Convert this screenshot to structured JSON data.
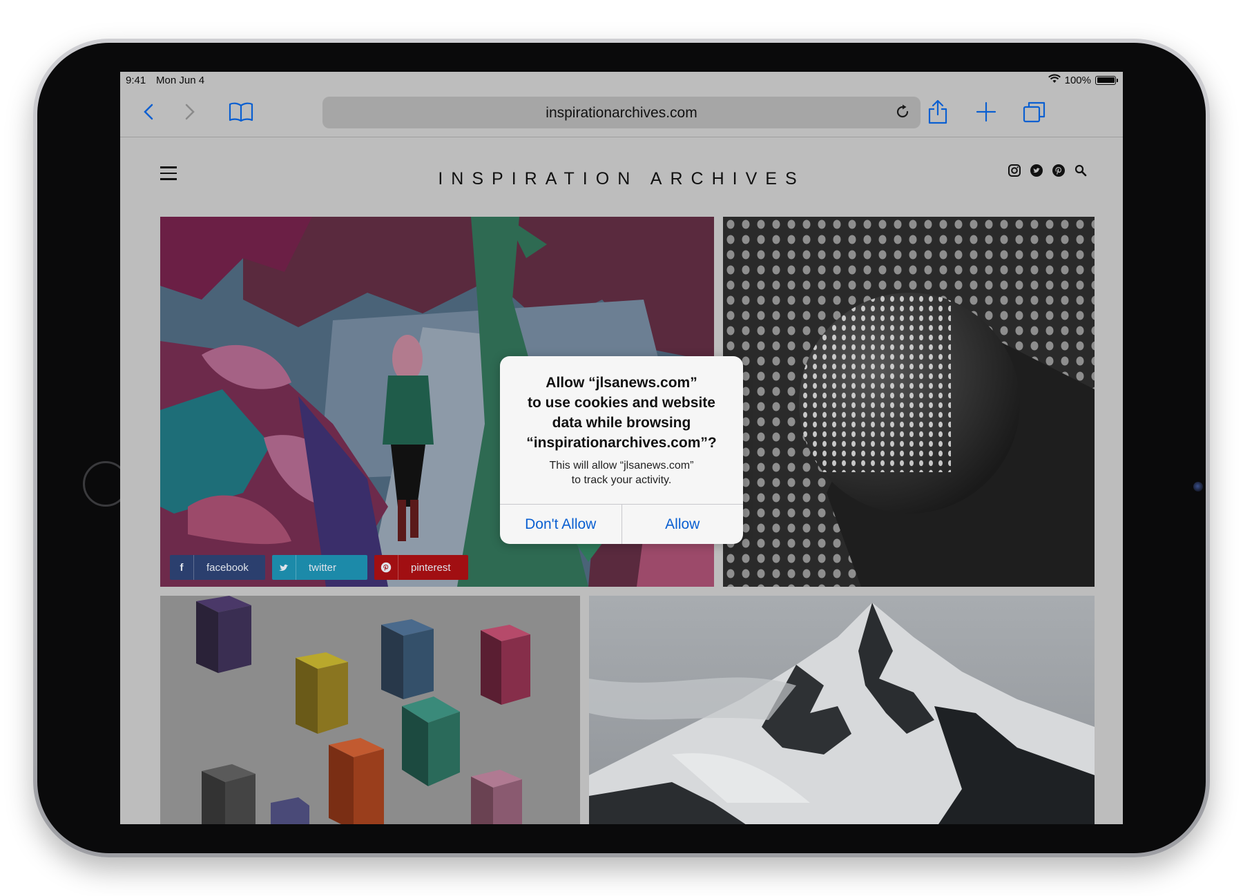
{
  "status_bar": {
    "time": "9:41",
    "date": "Mon Jun 4",
    "battery": "100%"
  },
  "browser": {
    "url": "inspirationarchives.com"
  },
  "site": {
    "title": "INSPIRATION ARCHIVES",
    "share_buttons": [
      {
        "icon": "f",
        "label": "facebook"
      },
      {
        "icon": "",
        "label": "twitter"
      },
      {
        "icon": "",
        "label": "pinterest"
      }
    ]
  },
  "dialog": {
    "title_lines": [
      "Allow “jlsanews.com”",
      "to use cookies and website",
      "data while browsing",
      "“inspirationarchives.com”?"
    ],
    "message_lines": [
      "This will allow “jlsanews.com”",
      "to track your activity."
    ],
    "deny_label": "Don't Allow",
    "allow_label": "Allow"
  },
  "colors": {
    "accent": "#0a5fd1",
    "facebook": "#2b3f6e",
    "twitter": "#1c8aa9",
    "pinterest": "#a10f12",
    "dim_overlay": "#bdbdbd"
  }
}
